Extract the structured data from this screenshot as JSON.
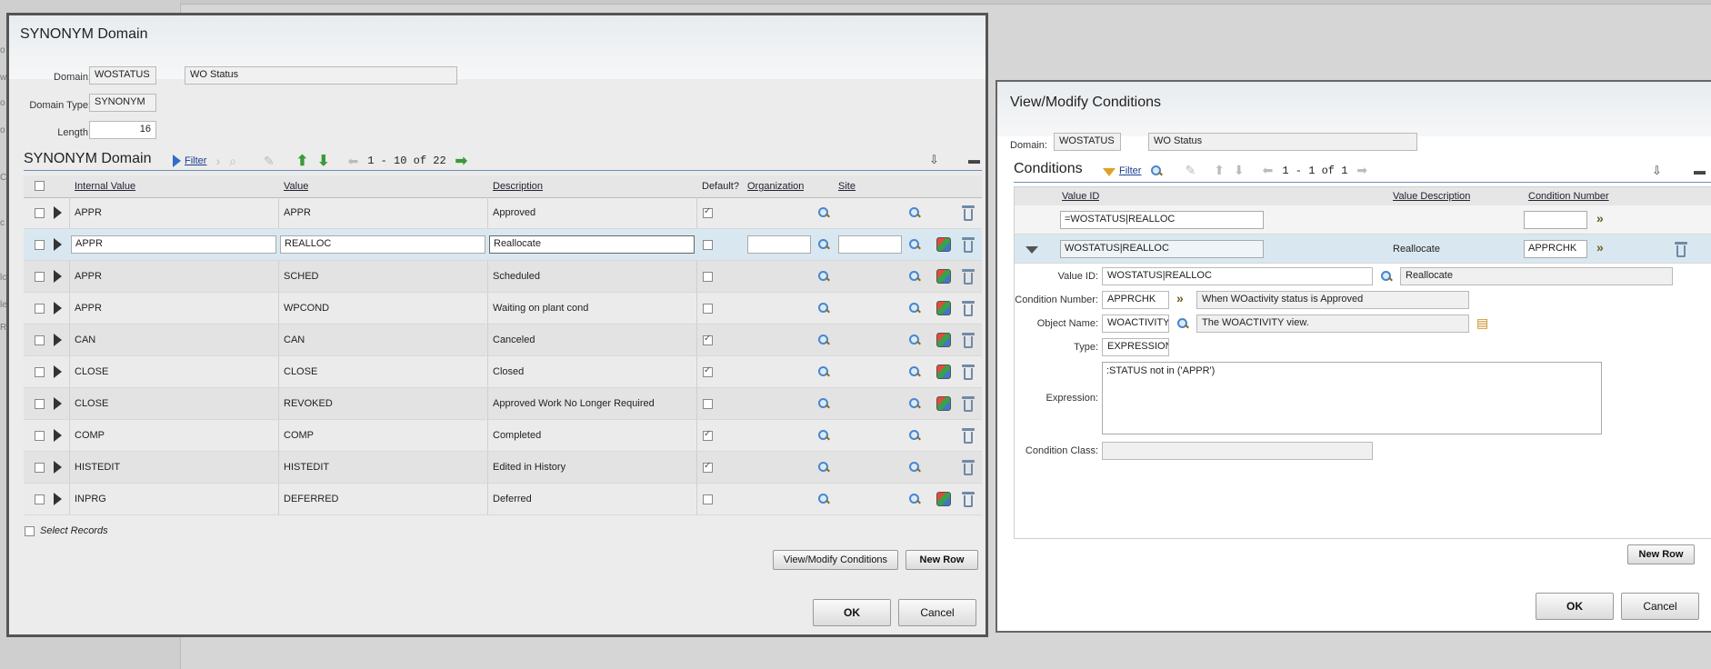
{
  "dialog1": {
    "title": "SYNONYM Domain",
    "domain_label": "Domain:",
    "domain_value": "WOSTATUS",
    "domain_desc": "WO Status",
    "type_label": "Domain Type:",
    "type_value": "SYNONYM",
    "length_label": "Length:",
    "length_value": "16",
    "table_title": "SYNONYM Domain",
    "filter_label": "Filter",
    "pager": "1 - 10 of 22",
    "columns": [
      "Internal Value",
      "Value",
      "Description",
      "Default?",
      "Organization",
      "Site"
    ],
    "rows": [
      {
        "internal": "APPR",
        "value": "APPR",
        "desc": "Approved",
        "default": true
      },
      {
        "internal": "APPR",
        "value": "REALLOC",
        "desc": "Reallocate",
        "default": false
      },
      {
        "internal": "APPR",
        "value": "SCHED",
        "desc": "Scheduled",
        "default": false
      },
      {
        "internal": "APPR",
        "value": "WPCOND",
        "desc": "Waiting on plant cond",
        "default": false
      },
      {
        "internal": "CAN",
        "value": "CAN",
        "desc": "Canceled",
        "default": true
      },
      {
        "internal": "CLOSE",
        "value": "CLOSE",
        "desc": "Closed",
        "default": true
      },
      {
        "internal": "CLOSE",
        "value": "REVOKED",
        "desc": "Approved Work No Longer Required",
        "default": false
      },
      {
        "internal": "COMP",
        "value": "COMP",
        "desc": "Completed",
        "default": true
      },
      {
        "internal": "HISTEDIT",
        "value": "HISTEDIT",
        "desc": "Edited in History",
        "default": true
      },
      {
        "internal": "INPRG",
        "value": "DEFERRED",
        "desc": "Deferred",
        "default": false
      }
    ],
    "select_records": "Select Records",
    "view_modify_btn": "View/Modify Conditions",
    "new_row_btn": "New Row",
    "ok_btn": "OK",
    "cancel_btn": "Cancel"
  },
  "dialog2": {
    "title": "View/Modify Conditions",
    "domain_label": "Domain:",
    "domain_value": "WOSTATUS",
    "domain_desc": "WO Status",
    "section_title": "Conditions",
    "filter_label": "Filter",
    "pager": "1 - 1 of 1",
    "columns": [
      "Value ID",
      "Value Description",
      "Condition Number"
    ],
    "filter_value": "=WOSTATUS|REALLOC",
    "row": {
      "value_id": "WOSTATUS|REALLOC",
      "value_desc": "Reallocate",
      "cond_num": "APPRCHK"
    },
    "detail": {
      "value_id_label": "Value ID:",
      "value_id": "WOSTATUS|REALLOC",
      "value_id_desc": "Reallocate",
      "cond_num_label": "Condition Number:",
      "cond_num": "APPRCHK",
      "cond_num_desc": "When WOactivity status is Approved",
      "object_label": "Object Name:",
      "object_value": "WOACTIVITY",
      "object_desc": "The WOACTIVITY view.",
      "type_label": "Type:",
      "type_value": "EXPRESSION",
      "expr_label": "Expression:",
      "expr_value": ":STATUS not in ('APPR')",
      "class_label": "Condition Class:",
      "class_value": ""
    },
    "new_row_btn": "New Row",
    "ok_btn": "OK",
    "cancel_btn": "Cancel"
  }
}
